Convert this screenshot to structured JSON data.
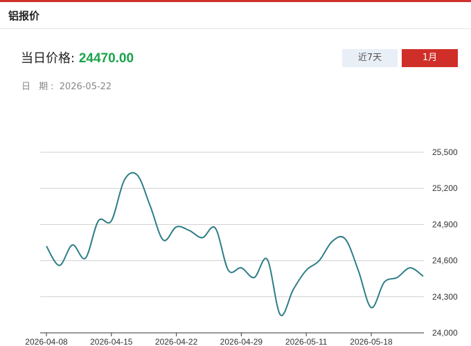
{
  "header": {
    "title": "铝报价"
  },
  "price": {
    "label": "当日价格:",
    "value": "24470.00"
  },
  "date": {
    "label": "日 期:",
    "value": "2026-05-22"
  },
  "range_buttons": {
    "week": "近7天",
    "month": "1月"
  },
  "colors": {
    "accent": "#d0302a",
    "price": "#1aa34a",
    "line": "#2d7d86",
    "active_button": "#cf2f28",
    "inactive_button": "#e9eff6"
  },
  "chart_data": {
    "type": "line",
    "x": [
      "2026-04-08",
      "2026-04-09",
      "2026-04-10",
      "2026-04-13",
      "2026-04-14",
      "2026-04-15",
      "2026-04-16",
      "2026-04-17",
      "2026-04-20",
      "2026-04-21",
      "2026-04-22",
      "2026-04-23",
      "2026-04-24",
      "2026-04-27",
      "2026-04-28",
      "2026-04-29",
      "2026-04-30",
      "2026-05-06",
      "2026-05-07",
      "2026-05-08",
      "2026-05-11",
      "2026-05-12",
      "2026-05-13",
      "2026-05-14",
      "2026-05-15",
      "2026-05-18",
      "2026-05-19",
      "2026-05-20",
      "2026-05-21",
      "2026-05-22"
    ],
    "values": [
      24720,
      24560,
      24730,
      24620,
      24930,
      24930,
      25270,
      25310,
      25050,
      24770,
      24880,
      24850,
      24790,
      24870,
      24520,
      24540,
      24460,
      24610,
      24150,
      24360,
      24520,
      24600,
      24760,
      24780,
      24520,
      24210,
      24420,
      24460,
      24540,
      24470
    ],
    "xticks": [
      "2026-04-08",
      "2026-04-15",
      "2026-04-22",
      "2026-04-29",
      "2026-05-11",
      "2026-05-18"
    ],
    "yticks": [
      "25,500",
      "25,200",
      "24,900",
      "24,600",
      "24,300",
      "24,000"
    ],
    "ytick_values": [
      25500,
      25200,
      24900,
      24600,
      24300,
      24000
    ],
    "ylim": [
      24000,
      25500
    ],
    "grid": true,
    "y_axis_side": "right"
  }
}
